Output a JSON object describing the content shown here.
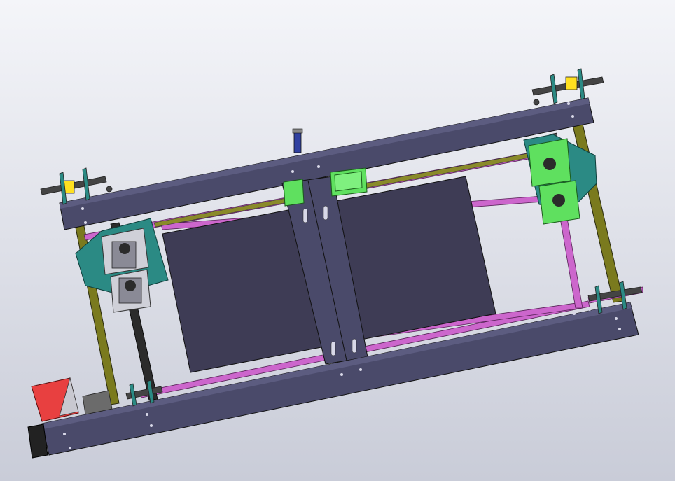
{
  "scene": {
    "kind": "cad-3d-viewport",
    "subject": "gantry-frame-assembly",
    "background": {
      "top": "#f4f5f9",
      "bottom": "#c9ccd8"
    }
  },
  "colors": {
    "frame_rail": "#4a4a6a",
    "panel": "#3e3c55",
    "rod_magenta": "#cc66cc",
    "rod_yellow": "#7a7a1e",
    "leadscrew": "#2b2b2b",
    "bearing_block_green": "#5fe05f",
    "pillow_block_teal": "#2b8a84",
    "motor_red": "#e84040",
    "motor_body": "#222222",
    "coupler": "#6b6b6b",
    "idler_yellow": "#ffe020",
    "sensor_blue": "#3040a0"
  },
  "parts": [
    {
      "id": "top-rail",
      "icon": "frame-rail"
    },
    {
      "id": "bottom-rail",
      "icon": "frame-rail"
    },
    {
      "id": "bed-plate",
      "icon": "panel"
    },
    {
      "id": "carriage-plate",
      "icon": "plate"
    },
    {
      "id": "stepper-motor",
      "icon": "motor"
    },
    {
      "id": "lead-screw",
      "icon": "screw"
    }
  ]
}
